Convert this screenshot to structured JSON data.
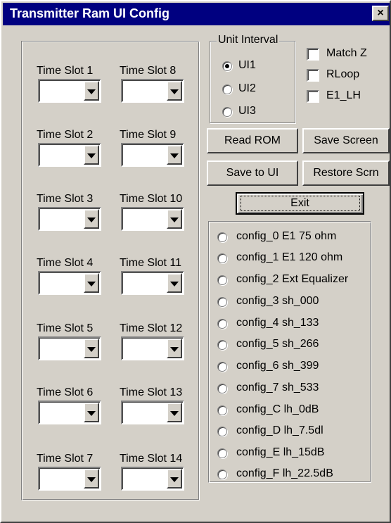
{
  "window": {
    "title": "Transmitter Ram UI Config",
    "close_glyph": "×"
  },
  "time_slots": [
    {
      "label": "Time Slot 1",
      "value": ""
    },
    {
      "label": "Time Slot 2",
      "value": ""
    },
    {
      "label": "Time Slot 3",
      "value": ""
    },
    {
      "label": "Time Slot 4",
      "value": ""
    },
    {
      "label": "Time Slot 5",
      "value": ""
    },
    {
      "label": "Time Slot 6",
      "value": ""
    },
    {
      "label": "Time Slot 7",
      "value": ""
    },
    {
      "label": "Time Slot 8",
      "value": ""
    },
    {
      "label": "Time Slot 9",
      "value": ""
    },
    {
      "label": "Time Slot 10",
      "value": ""
    },
    {
      "label": "Time Slot 11",
      "value": ""
    },
    {
      "label": "Time Slot 12",
      "value": ""
    },
    {
      "label": "Time Slot 13",
      "value": ""
    },
    {
      "label": "Time Slot 14",
      "value": ""
    }
  ],
  "unit_interval": {
    "legend": "Unit Interval",
    "options": [
      {
        "label": "UI1",
        "selected": true
      },
      {
        "label": "UI2",
        "selected": false
      },
      {
        "label": "UI3",
        "selected": false
      }
    ]
  },
  "checkboxes": [
    {
      "label": "Match Z",
      "checked": false
    },
    {
      "label": "RLoop",
      "checked": false
    },
    {
      "label": "E1_LH",
      "checked": false
    }
  ],
  "buttons": {
    "read_rom": "Read ROM",
    "save_screen": "Save Screen",
    "save_to_ui": "Save to UI",
    "restore_scrn": "Restore Scrn",
    "exit": "Exit"
  },
  "configs": [
    {
      "label": "config_0  E1 75 ohm",
      "selected": false
    },
    {
      "label": "config_1  E1 120 ohm",
      "selected": false
    },
    {
      "label": "config_2  Ext Equalizer",
      "selected": false
    },
    {
      "label": "config_3 sh_000",
      "selected": false
    },
    {
      "label": "config_4 sh_133",
      "selected": false
    },
    {
      "label": "config_5 sh_266",
      "selected": false
    },
    {
      "label": "config_6 sh_399",
      "selected": false
    },
    {
      "label": "config_7 sh_533",
      "selected": false
    },
    {
      "label": "config_C lh_0dB",
      "selected": false
    },
    {
      "label": "config_D lh_7.5dl",
      "selected": false
    },
    {
      "label": "config_E lh_15dB",
      "selected": false
    },
    {
      "label": "config_F lh_22.5dB",
      "selected": false
    }
  ],
  "colors": {
    "titlebar": "#000080",
    "face": "#d4d0c8"
  }
}
